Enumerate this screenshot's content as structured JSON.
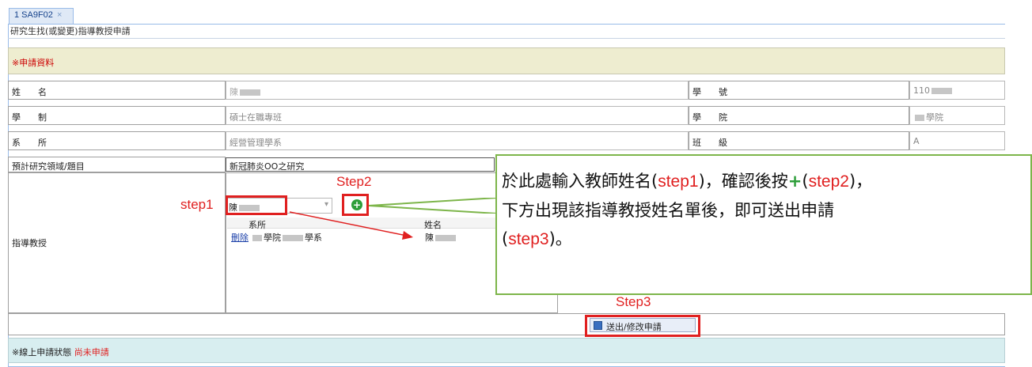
{
  "tab": {
    "label": "1 SA9F02",
    "close": "×"
  },
  "panel_title": "研究生找(或變更)指導教授申請",
  "section_apply": "※申請資料",
  "fields": {
    "name_label": "姓　　名",
    "name_value": "陳",
    "student_id_label": "學　　號",
    "student_id_value": "110",
    "program_label": "學　　制",
    "program_value": "碩士在職專班",
    "college_label": "學　　院",
    "college_value": "學院",
    "dept_label": "系　　所",
    "dept_value": "經營管理學系",
    "class_label": "班　　級",
    "class_value": "A",
    "topic_label": "預計研究領域/題目",
    "topic_value": "新冠肺炎OO之研究",
    "advisor_label": "指導教授"
  },
  "advisor_search": {
    "value": "陳"
  },
  "advisor_table": {
    "headers": [
      "系所",
      "姓名"
    ],
    "rows": [
      {
        "delete": "刪除",
        "dept_a": "學院",
        "dept_b": "學系",
        "name": "陳"
      }
    ]
  },
  "submit_button": "送出/修改申請",
  "status": {
    "label": "※線上申請狀態",
    "value": "尚未申請"
  },
  "annotations": {
    "step1": "step1",
    "step2": "Step2",
    "step3": "Step3",
    "callout": {
      "p1": "於此處輸入教師姓名(",
      "s1": "step1",
      "p2": ")，確認後按",
      "plus": "+",
      "p3": "(",
      "s2": "step2",
      "p4": ")，",
      "p5": "下方出現該指導教授姓名單後，即可送出申請",
      "p6": "(",
      "s3": "step3",
      "p7": ")。"
    }
  },
  "colors": {
    "accent_red": "#e02020",
    "callout_green": "#7db54a",
    "apply_bg": "#eeedd0",
    "status_bg": "#d8eef0"
  }
}
